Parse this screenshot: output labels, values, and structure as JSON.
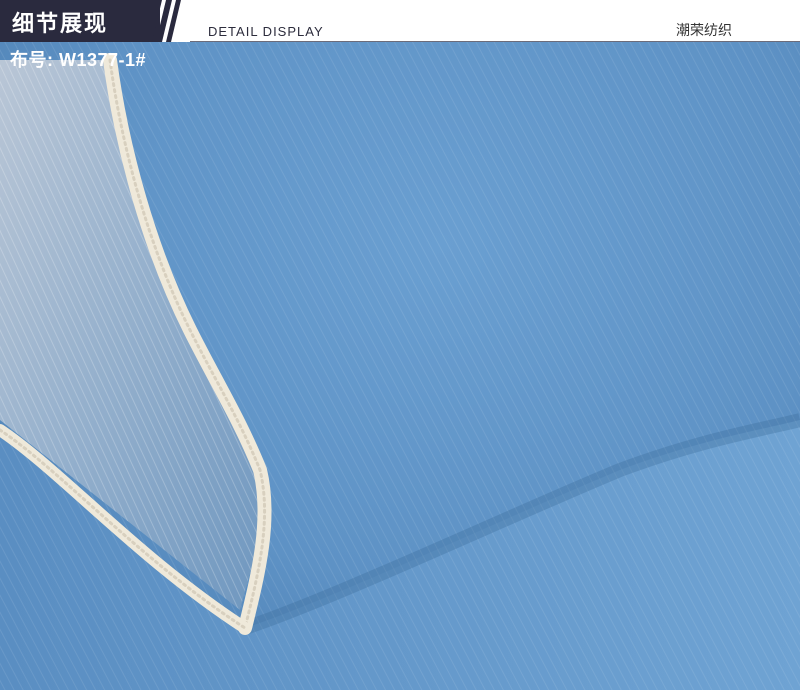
{
  "header": {
    "title_cn": "细节展现",
    "title_en": "DETAIL DISPLAY",
    "brand": "潮荣纺织"
  },
  "product": {
    "code_label": "布号: W1377-1#"
  },
  "photo": {
    "subject": "light-wash denim fabric",
    "colors": {
      "denim": "#5f93c6",
      "denim_light": "#7aaedb",
      "denim_dark": "#3f74a8",
      "selvedge": "#efe9da",
      "title_bg": "#2a2a3e"
    }
  }
}
